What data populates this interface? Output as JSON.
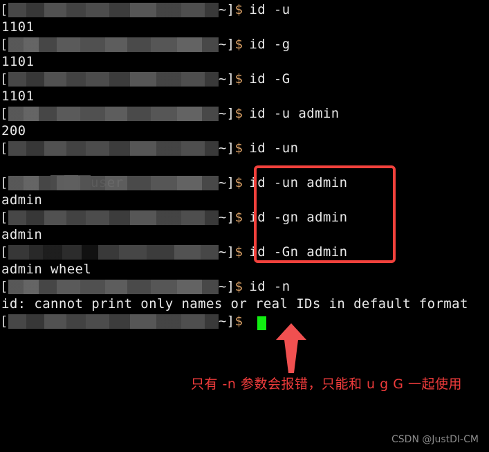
{
  "terminal": {
    "background_color": "#000000",
    "foreground_color": "#e8e8e8",
    "prompt_symbol_color": "#d9a066",
    "bracket_open": "[",
    "prompt_tail": "~]",
    "dollar": "$",
    "cursor_color": "#11ee11",
    "lines": [
      {
        "type": "prompt",
        "command": "id -u"
      },
      {
        "type": "output",
        "text": "1101"
      },
      {
        "type": "prompt",
        "command": "id -g"
      },
      {
        "type": "output",
        "text": "1101"
      },
      {
        "type": "prompt",
        "command": "id -G"
      },
      {
        "type": "output",
        "text": "1101"
      },
      {
        "type": "prompt",
        "command": "id -u admin"
      },
      {
        "type": "output",
        "text": "200"
      },
      {
        "type": "prompt",
        "command": "id -un"
      },
      {
        "type": "output_redacted",
        "text": "user"
      },
      {
        "type": "prompt",
        "command": "id -un admin"
      },
      {
        "type": "output",
        "text": "admin"
      },
      {
        "type": "prompt",
        "command": "id -gn admin"
      },
      {
        "type": "output",
        "text": "admin"
      },
      {
        "type": "prompt",
        "command": "id -Gn admin"
      },
      {
        "type": "output",
        "text": "admin wheel"
      },
      {
        "type": "prompt",
        "command": "id -n"
      },
      {
        "type": "output",
        "text": "id: cannot print only names or real IDs in default format"
      },
      {
        "type": "prompt",
        "command": ""
      }
    ]
  },
  "annotations": {
    "highlight_box": {
      "color": "#f2413c",
      "encloses": [
        "id -un admin",
        "id -gn admin",
        "id -Gn admin"
      ]
    },
    "arrow": {
      "color": "#f05050",
      "direction": "up",
      "points_at": "prompt-cursor"
    },
    "note_text": "只有 -n 参数会报错，只能和 u g G 一起使用",
    "note_color": "#ee3b3b"
  },
  "watermark": {
    "text": "CSDN @JustDI-CM",
    "color": "#8b8b8b"
  }
}
